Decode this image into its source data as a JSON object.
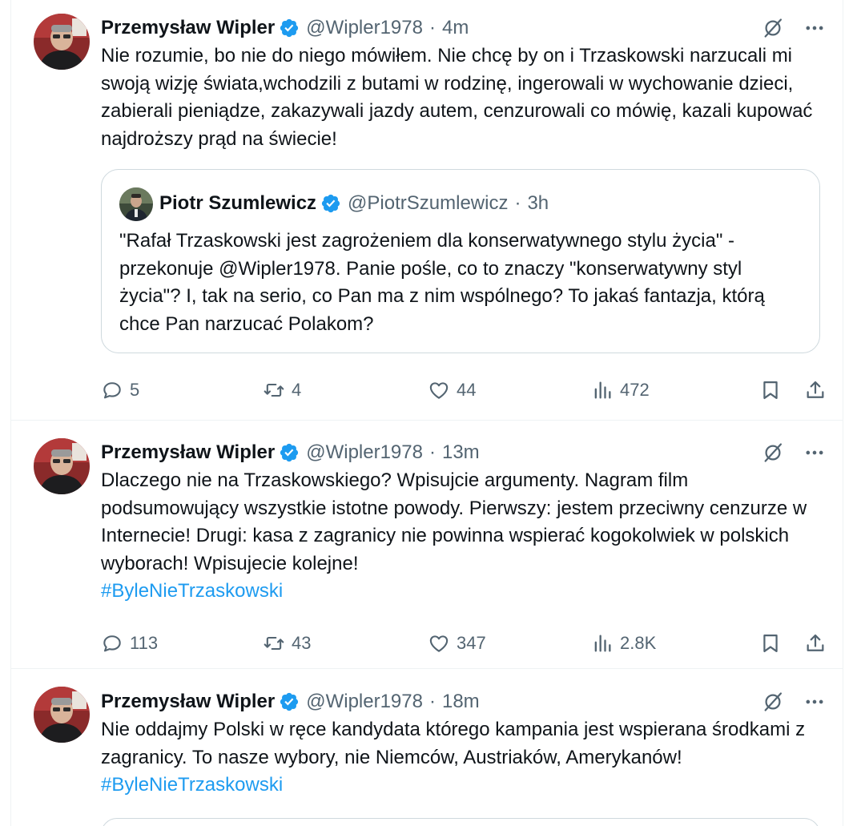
{
  "tweets": [
    {
      "author_name": "Przemysław Wipler",
      "handle": "@Wipler1978",
      "separator": "·",
      "time": "4m",
      "text": "Nie rozumie, bo nie do niego mówiłem. Nie chcę by on i Trzaskowski narzucali mi swoją wizję świata,wchodzili z butami w rodzinę, ingerowali w wychowanie dzieci, zabierali pieniądze, zakazywali jazdy autem, cenzurowali co mówię, kazali kupować najdroższy prąd na świecie!",
      "quote": {
        "author_name": "Piotr Szumlewicz",
        "handle": "@PiotrSzumlewicz",
        "separator": "·",
        "time": "3h",
        "text": "\"Rafał Trzaskowski jest zagrożeniem dla konserwatywnego stylu życia\" - przekonuje @Wipler1978. Panie pośle, co to znaczy \"konserwatywny styl życia\"? I, tak na serio, co Pan ma z nim wspólnego? To jakaś fantazja, którą chce Pan narzucać Polakom?"
      },
      "stats": {
        "replies": "5",
        "retweets": "4",
        "likes": "44",
        "views": "472"
      }
    },
    {
      "author_name": "Przemysław Wipler",
      "handle": "@Wipler1978",
      "separator": "·",
      "time": "13m",
      "text": "Dlaczego nie na Trzaskowskiego? Wpisujcie argumenty. Nagram film podsumowujący wszystkie istotne powody. Pierwszy: jestem przeciwny cenzurze w Internecie! Drugi: kasa z zagranicy nie powinna wspierać kogokolwiek w polskich wyborach! Wpisujecie kolejne!",
      "hashtag": "#ByleNieTrzaskowski",
      "stats": {
        "replies": "113",
        "retweets": "43",
        "likes": "347",
        "views": "2.8K"
      }
    },
    {
      "author_name": "Przemysław Wipler",
      "handle": "@Wipler1978",
      "separator": "·",
      "time": "18m",
      "text": "Nie oddajmy Polski w ręce kandydata którego kampania jest wspierana środkami z zagranicy. To nasze wybory, nie Niemców, Austriaków, Amerykanów!",
      "hashtag": "#ByleNieTrzaskowski"
    }
  ],
  "colors": {
    "text": "#0f1419",
    "secondary": "#536471",
    "accent": "#1d9bf0",
    "border": "#eff3f4"
  },
  "icons": {
    "verified": "verified-badge-icon",
    "grok": "grok-icon",
    "more": "more-icon",
    "reply": "reply-icon",
    "retweet": "retweet-icon",
    "like": "heart-icon",
    "views": "views-icon",
    "bookmark": "bookmark-icon",
    "share": "share-icon"
  }
}
